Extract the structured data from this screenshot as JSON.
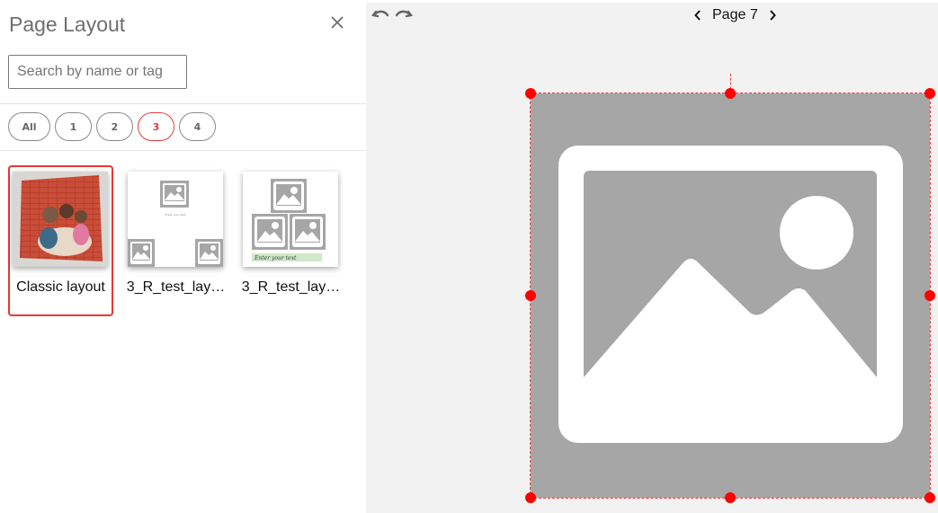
{
  "panel": {
    "title": "Page Layout",
    "search_placeholder": "Search by name or tag",
    "filters": [
      "All",
      "1",
      "2",
      "3",
      "4"
    ],
    "active_filter": "3",
    "layouts": [
      {
        "label": "Classic layout",
        "selected": true
      },
      {
        "label": "3_R_test_lay…",
        "selected": false
      },
      {
        "label": "3_R_test_lay…",
        "selected": false
      }
    ],
    "thumb_texts": {
      "layout2_caption": "Enter your text",
      "layout3_caption": "Enter your text"
    }
  },
  "editor": {
    "page_label": "Page 7"
  },
  "colors": {
    "accent": "#e53935",
    "handle": "#ff0000",
    "placeholder_gray": "#a6a6a6",
    "canvas_bg": "#f2f2f2"
  },
  "icons": [
    "close-icon",
    "undo-icon",
    "redo-icon",
    "chevron-left-icon",
    "chevron-right-icon",
    "image-placeholder-icon"
  ]
}
